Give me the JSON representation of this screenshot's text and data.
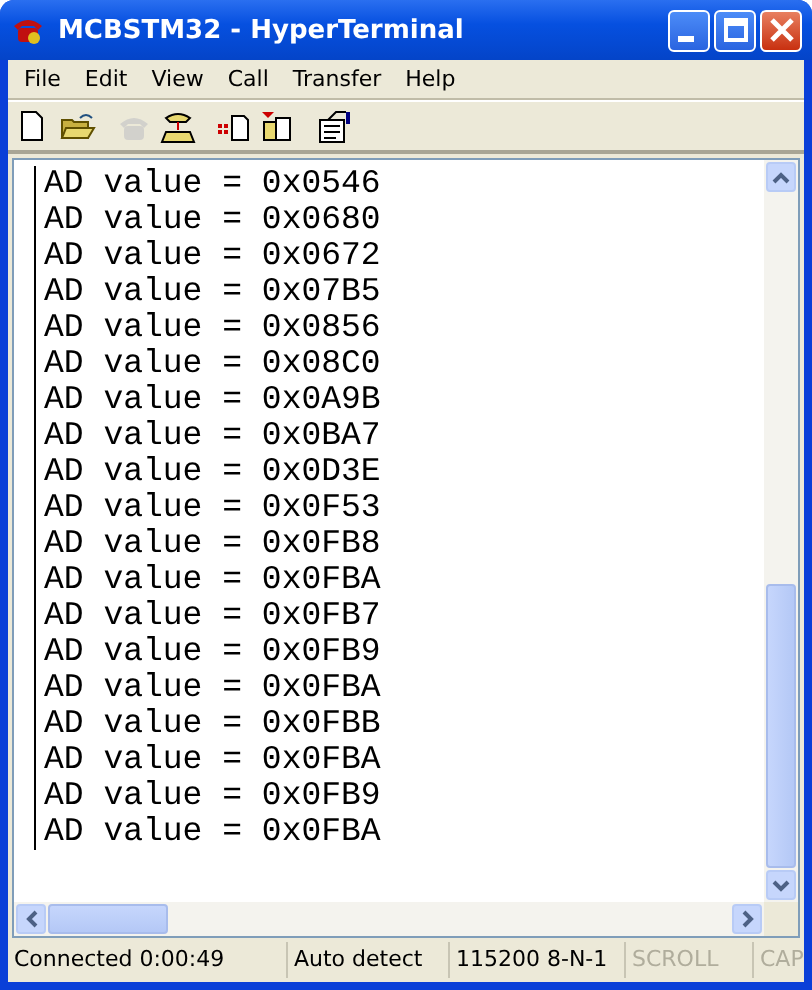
{
  "window": {
    "title": "MCBSTM32 - HyperTerminal"
  },
  "menu": [
    "File",
    "Edit",
    "View",
    "Call",
    "Transfer",
    "Help"
  ],
  "toolbar": [
    {
      "kind": "new",
      "disabled": false
    },
    {
      "kind": "open",
      "disabled": false
    },
    {
      "kind": "call",
      "disabled": true
    },
    {
      "kind": "disconnect",
      "disabled": false
    },
    {
      "kind": "send",
      "disabled": false
    },
    {
      "kind": "receive",
      "disabled": false
    },
    {
      "kind": "properties",
      "disabled": false
    }
  ],
  "terminal": {
    "lines": [
      "AD value = 0x0546",
      "AD value = 0x0680",
      "AD value = 0x0672",
      "AD value = 0x07B5",
      "AD value = 0x0856",
      "AD value = 0x08C0",
      "AD value = 0x0A9B",
      "AD value = 0x0BA7",
      "AD value = 0x0D3E",
      "AD value = 0x0F53",
      "AD value = 0x0FB8",
      "AD value = 0x0FBA",
      "AD value = 0x0FB7",
      "AD value = 0x0FB9",
      "AD value = 0x0FBA",
      "AD value = 0x0FBB",
      "AD value = 0x0FBA",
      "AD value = 0x0FB9",
      "AD value = 0x0FBA"
    ]
  },
  "status_bar": [
    {
      "text": "Connected 0:00:49",
      "disabled": false
    },
    {
      "text": "Auto detect",
      "disabled": false
    },
    {
      "text": "115200 8-N-1",
      "disabled": false
    },
    {
      "text": "SCROLL",
      "disabled": true
    },
    {
      "text": "CAP",
      "disabled": true
    }
  ]
}
